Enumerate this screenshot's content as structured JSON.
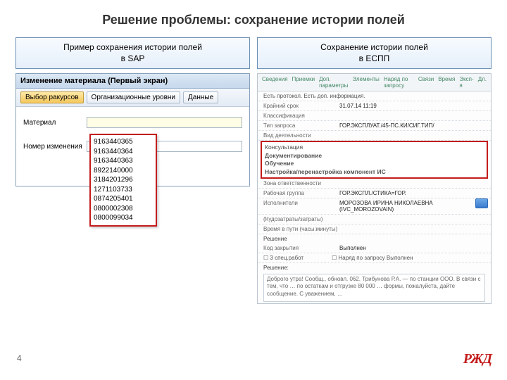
{
  "title": "Решение проблемы: сохранение истории полей",
  "left_header_l1": "Пример сохранения истории полей",
  "left_header_l2": "в SAP",
  "right_header_l1": "Сохранение истории полей",
  "right_header_l2": "в ЕСПП",
  "sap": {
    "window_title": "Изменение материала (Первый экран)",
    "btn_views": "Выбор ракурсов",
    "btn_orgs": "Организационные уровни",
    "btn_data": "Данные",
    "field_material": "Материал",
    "field_changeno": "Номер изменения",
    "dropdown": [
      "9163440365",
      "9163440364",
      "9163440363",
      "8922140000",
      "3184201296",
      "1271103733",
      "0874205401",
      "0800002308",
      "0800099034"
    ]
  },
  "espp": {
    "tabs": [
      "Сведения",
      "Приемки",
      "Доп. параметры",
      "Элементы",
      "Наряд по запросу",
      "Связи",
      "Время",
      "Эксп-я",
      "Дл."
    ],
    "info_line": "Есть протокол. Есть доп. информация.",
    "rows": [
      {
        "lbl": "Крайний срок",
        "val": "31.07.14 11:19"
      },
      {
        "lbl": "Классификация",
        "val": ""
      },
      {
        "lbl": "Тип запроса",
        "val": "ГОР.ЭКСПЛУАТ./45-ПС.КИ/СИГ.ТИП/"
      },
      {
        "lbl": "Вид деятельности",
        "val": ""
      }
    ],
    "highlight": [
      "Консультация",
      "Документирование",
      "Обучение",
      "Настройка/перенастройка компонент ИС"
    ],
    "rows2": [
      {
        "lbl": "Зона ответственности",
        "val": ""
      },
      {
        "lbl": "Рабочая группа",
        "val": "ГОР.ЭКСПЛ./СТИКА=ГОР."
      },
      {
        "lbl": "Исполнители",
        "val": "МОРОЗОВА ИРИНА НИКОЛАЕВНА (IVC_MOROZOVAIN)"
      },
      {
        "lbl": "(Кудозатраты/затраты)",
        "val": ""
      },
      {
        "lbl": "Время в пути (часы:минуты)",
        "val": ""
      }
    ],
    "section": "Решение",
    "rows3": [
      {
        "lbl": "Код закрытия",
        "val": "Выполнен"
      }
    ],
    "chk1": "3 спец.работ",
    "chk2": "Наряд по запросу Выполнен",
    "field_reshenie": "Решение:",
    "textarea": "Доброго утра!\nСообщ., обновл. 062. Трибунова Р.А. — по станции ООО.\n\nВ связи с тем, что … по остаткам и отгрузке 80 000 … формы, пожалуйста, дайте сообщение.\nС уважением, …"
  },
  "pagenum": "4",
  "logo": "РЖД"
}
